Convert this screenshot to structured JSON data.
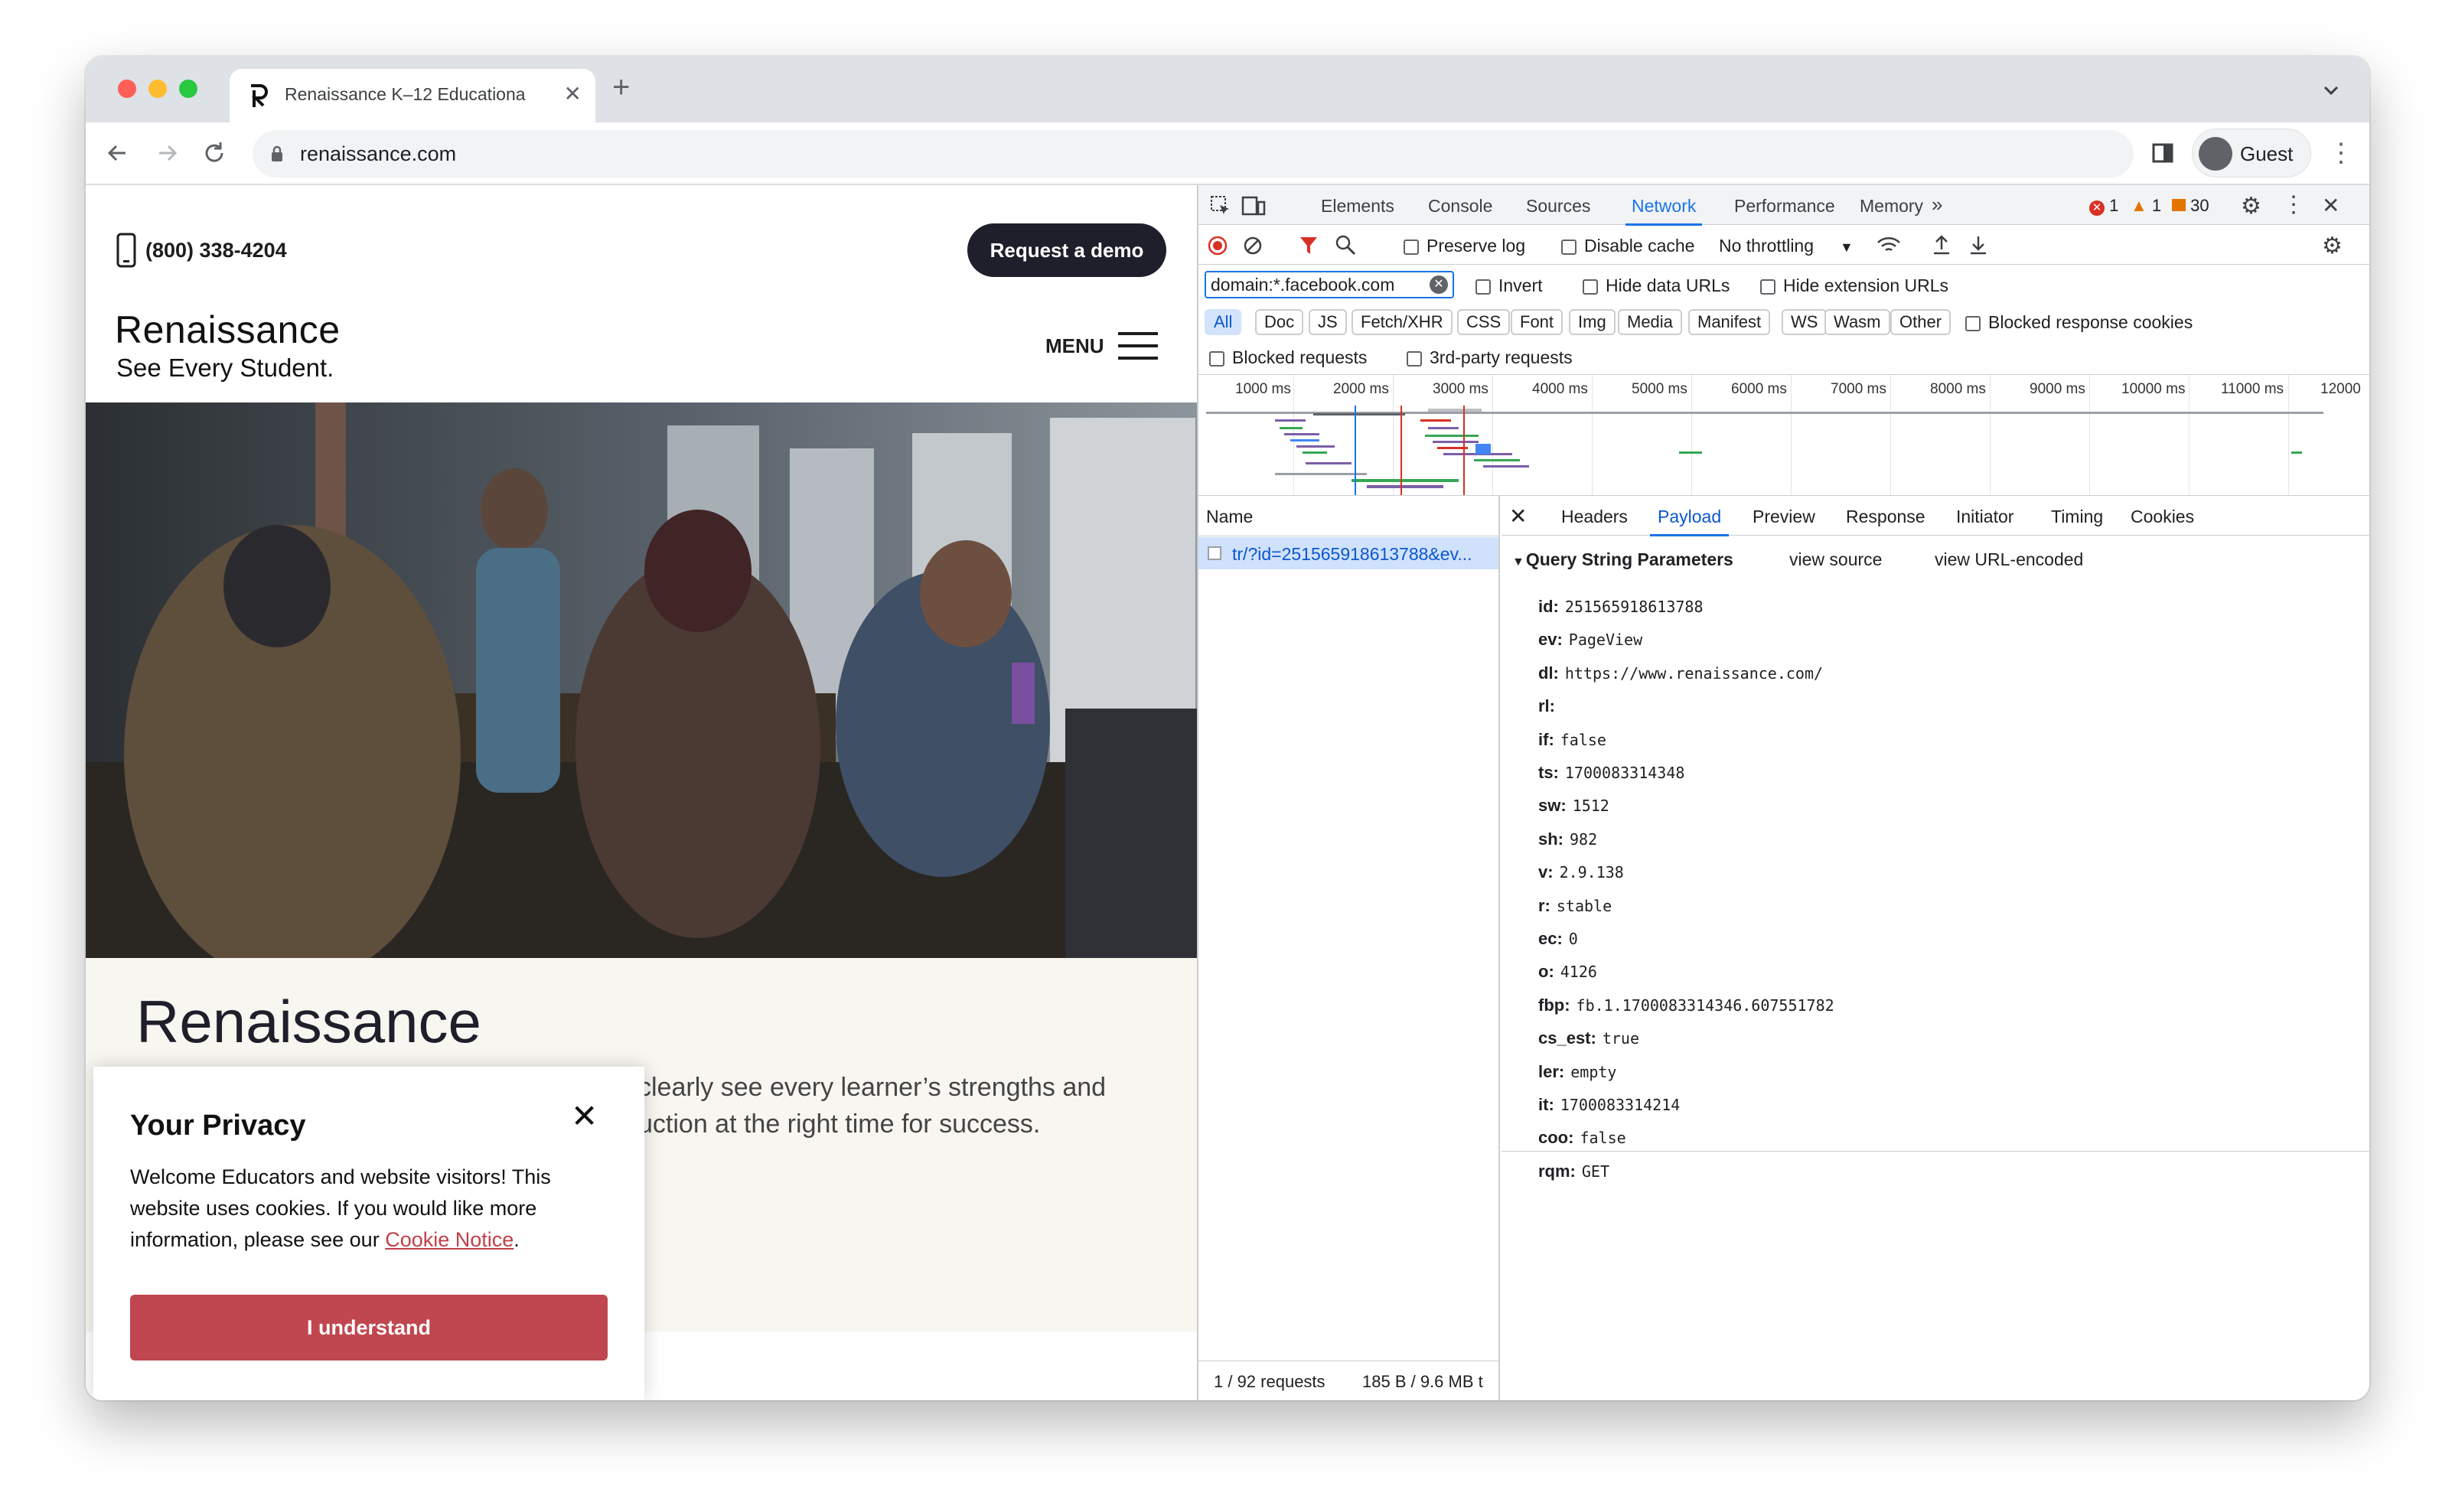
{
  "browser": {
    "tab_title": "Renaissance K–12 Educationa",
    "url": "renaissance.com",
    "profile_label": "Guest"
  },
  "site": {
    "phone": "(800) 338-4204",
    "demo_button": "Request a demo",
    "logo": "Renaissance",
    "tagline": "See Every Student.",
    "menu_label": "MENU",
    "lower_logo": "Renaissance",
    "body_line1": "clearly see every learner’s strengths and",
    "body_line2": "uction at the right time for success.",
    "privacy": {
      "title": "Your Privacy",
      "body": "Welcome Educators and website visitors! This website uses cookies. If you would like more information, please see our ",
      "link": "Cookie Notice",
      "after": ".",
      "button": "I understand"
    }
  },
  "devtools": {
    "tabs": [
      "Elements",
      "Console",
      "Sources",
      "Network",
      "Performance",
      "Memory"
    ],
    "active_tab": "Network",
    "counts": {
      "errors": "1",
      "warnings": "1",
      "issues": "30"
    },
    "toolbar": {
      "preserve_log": "Preserve log",
      "disable_cache": "Disable cache",
      "throttling": "No throttling"
    },
    "filter": {
      "value": "domain:*.facebook.com",
      "invert": "Invert",
      "hide_data": "Hide data URLs",
      "hide_ext": "Hide extension URLs"
    },
    "types": [
      "All",
      "Doc",
      "JS",
      "Fetch/XHR",
      "CSS",
      "Font",
      "Img",
      "Media",
      "Manifest",
      "WS",
      "Wasm",
      "Other"
    ],
    "blocked_cookies": "Blocked response cookies",
    "blocked_requests": "Blocked requests",
    "third_party": "3rd-party requests",
    "timeline_ticks": [
      "1000 ms",
      "2000 ms",
      "3000 ms",
      "4000 ms",
      "5000 ms",
      "6000 ms",
      "7000 ms",
      "8000 ms",
      "9000 ms",
      "10000 ms",
      "11000 ms",
      "12000"
    ],
    "name_header": "Name",
    "request_name": "tr/?id=251565918613788&ev...",
    "detail_tabs": [
      "Headers",
      "Payload",
      "Preview",
      "Response",
      "Initiator",
      "Timing",
      "Cookies"
    ],
    "active_detail_tab": "Payload",
    "qsp_title": "Query String Parameters",
    "view_source": "view source",
    "view_url_encoded": "view URL-encoded",
    "params": [
      {
        "k": "id:",
        "v": "251565918613788"
      },
      {
        "k": "ev:",
        "v": "PageView"
      },
      {
        "k": "dl:",
        "v": "https://www.renaissance.com/"
      },
      {
        "k": "rl:",
        "v": ""
      },
      {
        "k": "if:",
        "v": "false"
      },
      {
        "k": "ts:",
        "v": "1700083314348"
      },
      {
        "k": "sw:",
        "v": "1512"
      },
      {
        "k": "sh:",
        "v": "982"
      },
      {
        "k": "v:",
        "v": "2.9.138"
      },
      {
        "k": "r:",
        "v": "stable"
      },
      {
        "k": "ec:",
        "v": "0"
      },
      {
        "k": "o:",
        "v": "4126"
      },
      {
        "k": "fbp:",
        "v": "fb.1.1700083314346.607551782"
      },
      {
        "k": "cs_est:",
        "v": "true"
      },
      {
        "k": "ler:",
        "v": "empty"
      },
      {
        "k": "it:",
        "v": "1700083314214"
      },
      {
        "k": "coo:",
        "v": "false"
      },
      {
        "k": "rqm:",
        "v": "GET"
      }
    ],
    "status_requests": "1 / 92 requests",
    "status_size": "185 B / 9.6 MB t"
  }
}
